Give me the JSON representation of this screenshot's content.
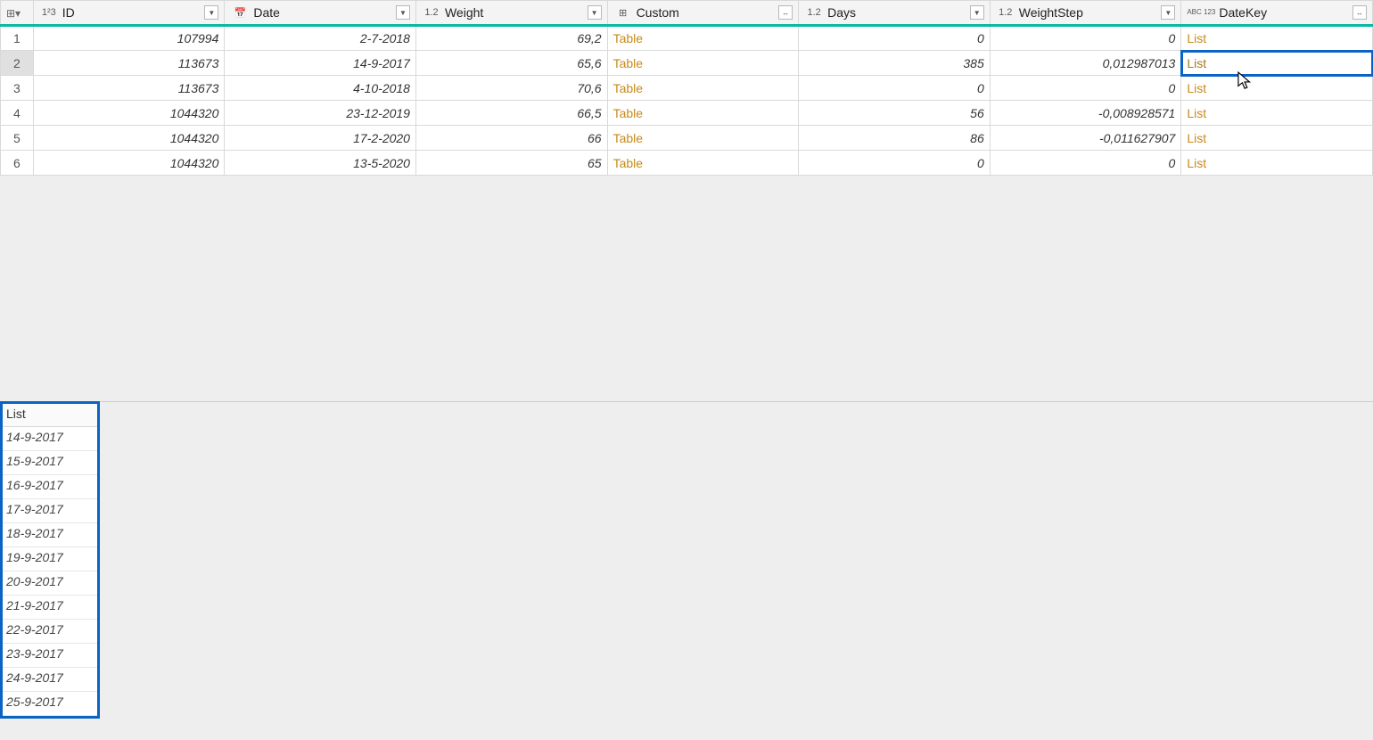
{
  "columns": [
    {
      "name": "ID",
      "typeIcon": "1²3",
      "control": "filter"
    },
    {
      "name": "Date",
      "typeIcon": "📅",
      "control": "filter"
    },
    {
      "name": "Weight",
      "typeIcon": "1.2",
      "control": "filter"
    },
    {
      "name": "Custom",
      "typeIcon": "⊞",
      "control": "expand"
    },
    {
      "name": "Days",
      "typeIcon": "1.2",
      "control": "filter"
    },
    {
      "name": "WeightStep",
      "typeIcon": "1.2",
      "control": "filter"
    },
    {
      "name": "DateKey",
      "typeIcon": "ABC 123",
      "control": "expand"
    }
  ],
  "rows": [
    {
      "idx": "1",
      "ID": "107994",
      "Date": "2-7-2018",
      "Weight": "69,2",
      "Custom": "Table",
      "Days": "0",
      "WeightStep": "0",
      "DateKey": "List"
    },
    {
      "idx": "2",
      "ID": "113673",
      "Date": "14-9-2017",
      "Weight": "65,6",
      "Custom": "Table",
      "Days": "385",
      "WeightStep": "0,012987013",
      "DateKey": "List",
      "selected": true
    },
    {
      "idx": "3",
      "ID": "113673",
      "Date": "4-10-2018",
      "Weight": "70,6",
      "Custom": "Table",
      "Days": "0",
      "WeightStep": "0",
      "DateKey": "List"
    },
    {
      "idx": "4",
      "ID": "1044320",
      "Date": "23-12-2019",
      "Weight": "66,5",
      "Custom": "Table",
      "Days": "56",
      "WeightStep": "-0,008928571",
      "DateKey": "List"
    },
    {
      "idx": "5",
      "ID": "1044320",
      "Date": "17-2-2020",
      "Weight": "66",
      "Custom": "Table",
      "Days": "86",
      "WeightStep": "-0,011627907",
      "DateKey": "List"
    },
    {
      "idx": "6",
      "ID": "1044320",
      "Date": "13-5-2020",
      "Weight": "65",
      "Custom": "Table",
      "Days": "0",
      "WeightStep": "0",
      "DateKey": "List"
    }
  ],
  "listPreview": {
    "header": "List",
    "items": [
      "14-9-2017",
      "15-9-2017",
      "16-9-2017",
      "17-9-2017",
      "18-9-2017",
      "19-9-2017",
      "20-9-2017",
      "21-9-2017",
      "22-9-2017",
      "23-9-2017",
      "24-9-2017",
      "25-9-2017"
    ]
  },
  "glyphs": {
    "filterDown": "▼",
    "expandArrows": "↔"
  }
}
